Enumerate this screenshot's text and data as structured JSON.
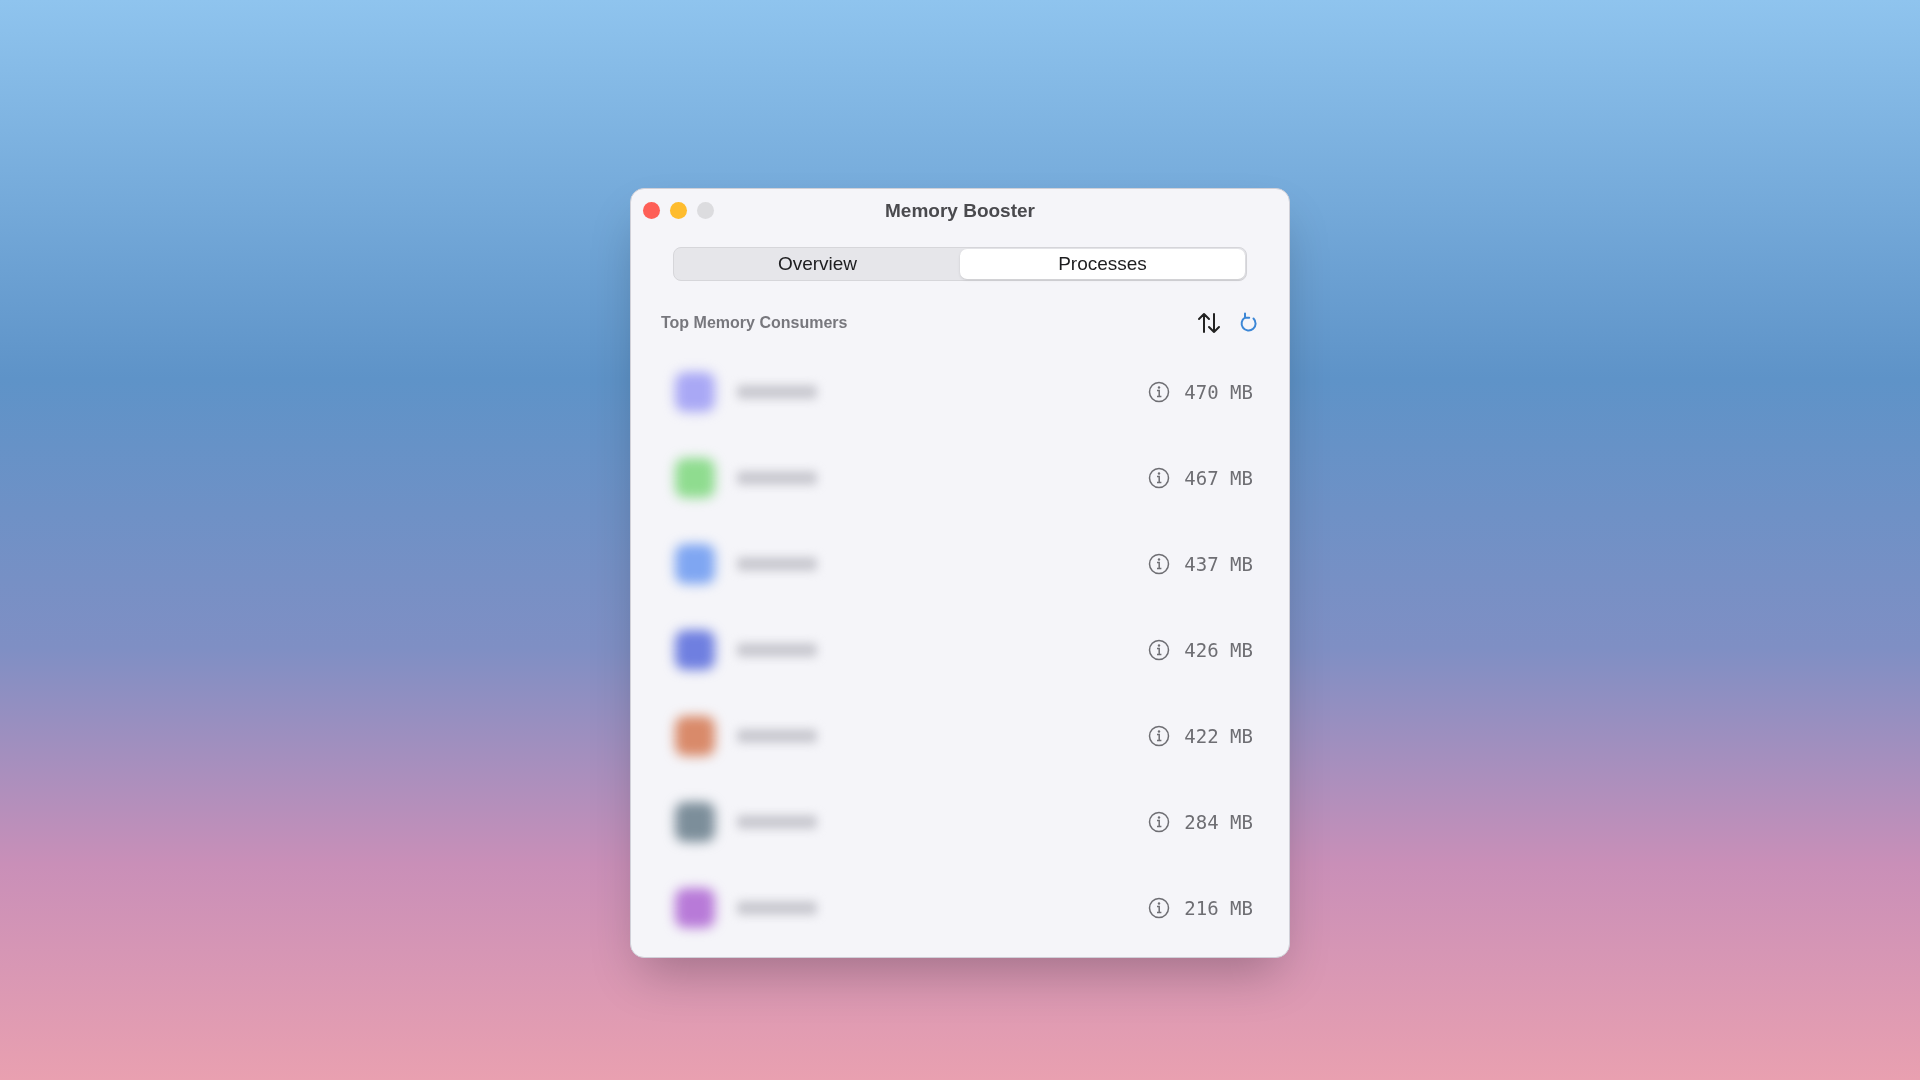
{
  "window": {
    "title": "Memory Booster"
  },
  "tabs": [
    {
      "label": "Overview",
      "selected": false
    },
    {
      "label": "Processes",
      "selected": true
    }
  ],
  "section": {
    "title": "Top Memory Consumers"
  },
  "processes": [
    {
      "color": "#a9a8f5",
      "memory": "470 MB"
    },
    {
      "color": "#8fdc8f",
      "memory": "467 MB"
    },
    {
      "color": "#7fa6f2",
      "memory": "437 MB"
    },
    {
      "color": "#6f7fe0",
      "memory": "426 MB"
    },
    {
      "color": "#d98a6a",
      "memory": "422 MB"
    },
    {
      "color": "#7c8e9a",
      "memory": "284 MB"
    },
    {
      "color": "#b87ad8",
      "memory": "216 MB"
    }
  ]
}
